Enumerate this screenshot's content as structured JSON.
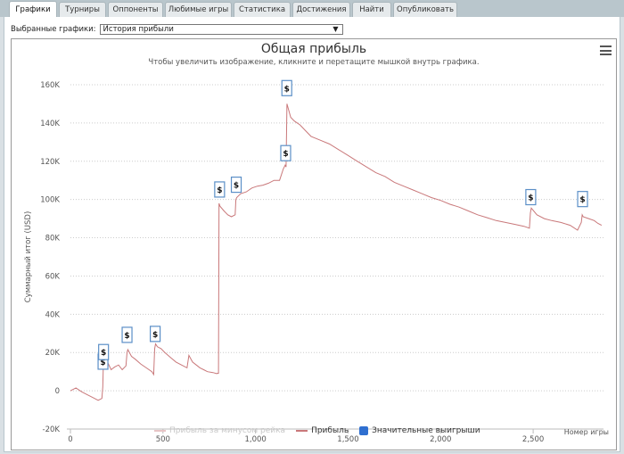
{
  "tabs": [
    {
      "label": "Графики",
      "active": true
    },
    {
      "label": "Турниры",
      "active": false
    },
    {
      "label": "Оппоненты",
      "active": false
    },
    {
      "label": "Любимые игры",
      "active": false
    },
    {
      "label": "Статистика",
      "active": false
    },
    {
      "label": "Достижения",
      "active": false
    },
    {
      "label": "Найти",
      "active": false
    },
    {
      "label": "Опубликовать",
      "active": false
    }
  ],
  "selector": {
    "label": "Выбранные графики:",
    "value": "История прибыли",
    "arrow": "▼"
  },
  "colors": {
    "line": "#c9787a",
    "line_dim": "#e8c4c5",
    "marker_border": "#5b8fc7",
    "legend_blue": "#2f6fd0",
    "grid": "#cccccc"
  },
  "chart_data": {
    "type": "line",
    "title": "Общая прибыль",
    "subtitle": "Чтобы увеличить изображение, кликните и перетащите мышкой внутрь графика.",
    "ylabel": "Суммарный итог (USD)",
    "xlabel": "Номер игры",
    "x_range": [
      0,
      2880
    ],
    "ylim": [
      -20000,
      160000
    ],
    "y_ticks": [
      -20000,
      0,
      20000,
      40000,
      60000,
      80000,
      100000,
      120000,
      140000,
      160000
    ],
    "y_tick_labels": [
      "-20K",
      "0",
      "20K",
      "40K",
      "60K",
      "80K",
      "100K",
      "120K",
      "140K",
      "160K"
    ],
    "x_ticks": [
      0,
      500,
      1000,
      1500,
      2000,
      2500
    ],
    "x_tick_labels": [
      "0",
      "500",
      "1,000",
      "1,500",
      "2,000",
      "2,500"
    ],
    "grid": true,
    "legend": [
      {
        "label": "Прибыль за минусом рейка",
        "style": "line-dim"
      },
      {
        "label": "Прибыль",
        "style": "line"
      },
      {
        "label": "Значительные выигрыши",
        "style": "marker"
      }
    ],
    "series": [
      {
        "name": "Прибыль",
        "x": [
          0,
          30,
          60,
          90,
          120,
          150,
          170,
          175,
          178,
          185,
          200,
          220,
          240,
          260,
          280,
          300,
          306,
          310,
          330,
          350,
          380,
          410,
          440,
          450,
          455,
          460,
          470,
          490,
          510,
          540,
          570,
          600,
          630,
          640,
          660,
          680,
          700,
          720,
          740,
          770,
          790,
          800,
          803,
          808,
          830,
          850,
          870,
          890,
          894,
          898,
          920,
          950,
          980,
          1010,
          1040,
          1070,
          1100,
          1130,
          1150,
          1160,
          1165,
          1170,
          1190,
          1210,
          1240,
          1270,
          1300,
          1350,
          1400,
          1450,
          1500,
          1550,
          1600,
          1650,
          1700,
          1750,
          1800,
          1850,
          1900,
          1950,
          2000,
          2050,
          2100,
          2150,
          2200,
          2250,
          2300,
          2350,
          2400,
          2450,
          2480,
          2485,
          2490,
          2520,
          2560,
          2600,
          2650,
          2700,
          2740,
          2760,
          2765,
          2770,
          2800,
          2830,
          2850,
          2870
        ],
        "y": [
          0,
          1500,
          -500,
          -2000,
          -3500,
          -5000,
          -4000,
          2000,
          15000,
          13000,
          15000,
          11000,
          12500,
          13500,
          11000,
          13000,
          20000,
          21500,
          18000,
          16500,
          14000,
          12000,
          10000,
          8500,
          22000,
          24500,
          23000,
          22000,
          20000,
          17500,
          15000,
          13500,
          12000,
          18500,
          15000,
          13500,
          12000,
          11000,
          10000,
          9500,
          9000,
          9200,
          98000,
          96500,
          94000,
          92000,
          91000,
          92000,
          100000,
          101000,
          103000,
          104000,
          106000,
          107000,
          107500,
          108500,
          110000,
          110000,
          116000,
          118000,
          117000,
          150000,
          143000,
          141000,
          139000,
          136000,
          133000,
          131000,
          129000,
          126000,
          123000,
          120000,
          117000,
          114000,
          112000,
          109000,
          107000,
          105000,
          103000,
          101000,
          99500,
          97500,
          96000,
          94000,
          92000,
          90500,
          89000,
          88000,
          87000,
          86000,
          85000,
          93000,
          95500,
          92000,
          90000,
          89000,
          88000,
          86500,
          84000,
          88000,
          92000,
          91000,
          90000,
          89000,
          87500,
          86500
        ]
      }
    ],
    "big_wins": {
      "label": "$",
      "x": [
        176,
        179,
        306,
        458,
        806,
        896,
        1163,
        1169,
        2487,
        2767
      ],
      "y": [
        15000,
        20000,
        29000,
        29500,
        105000,
        107500,
        124000,
        158000,
        101000,
        100000
      ]
    }
  }
}
